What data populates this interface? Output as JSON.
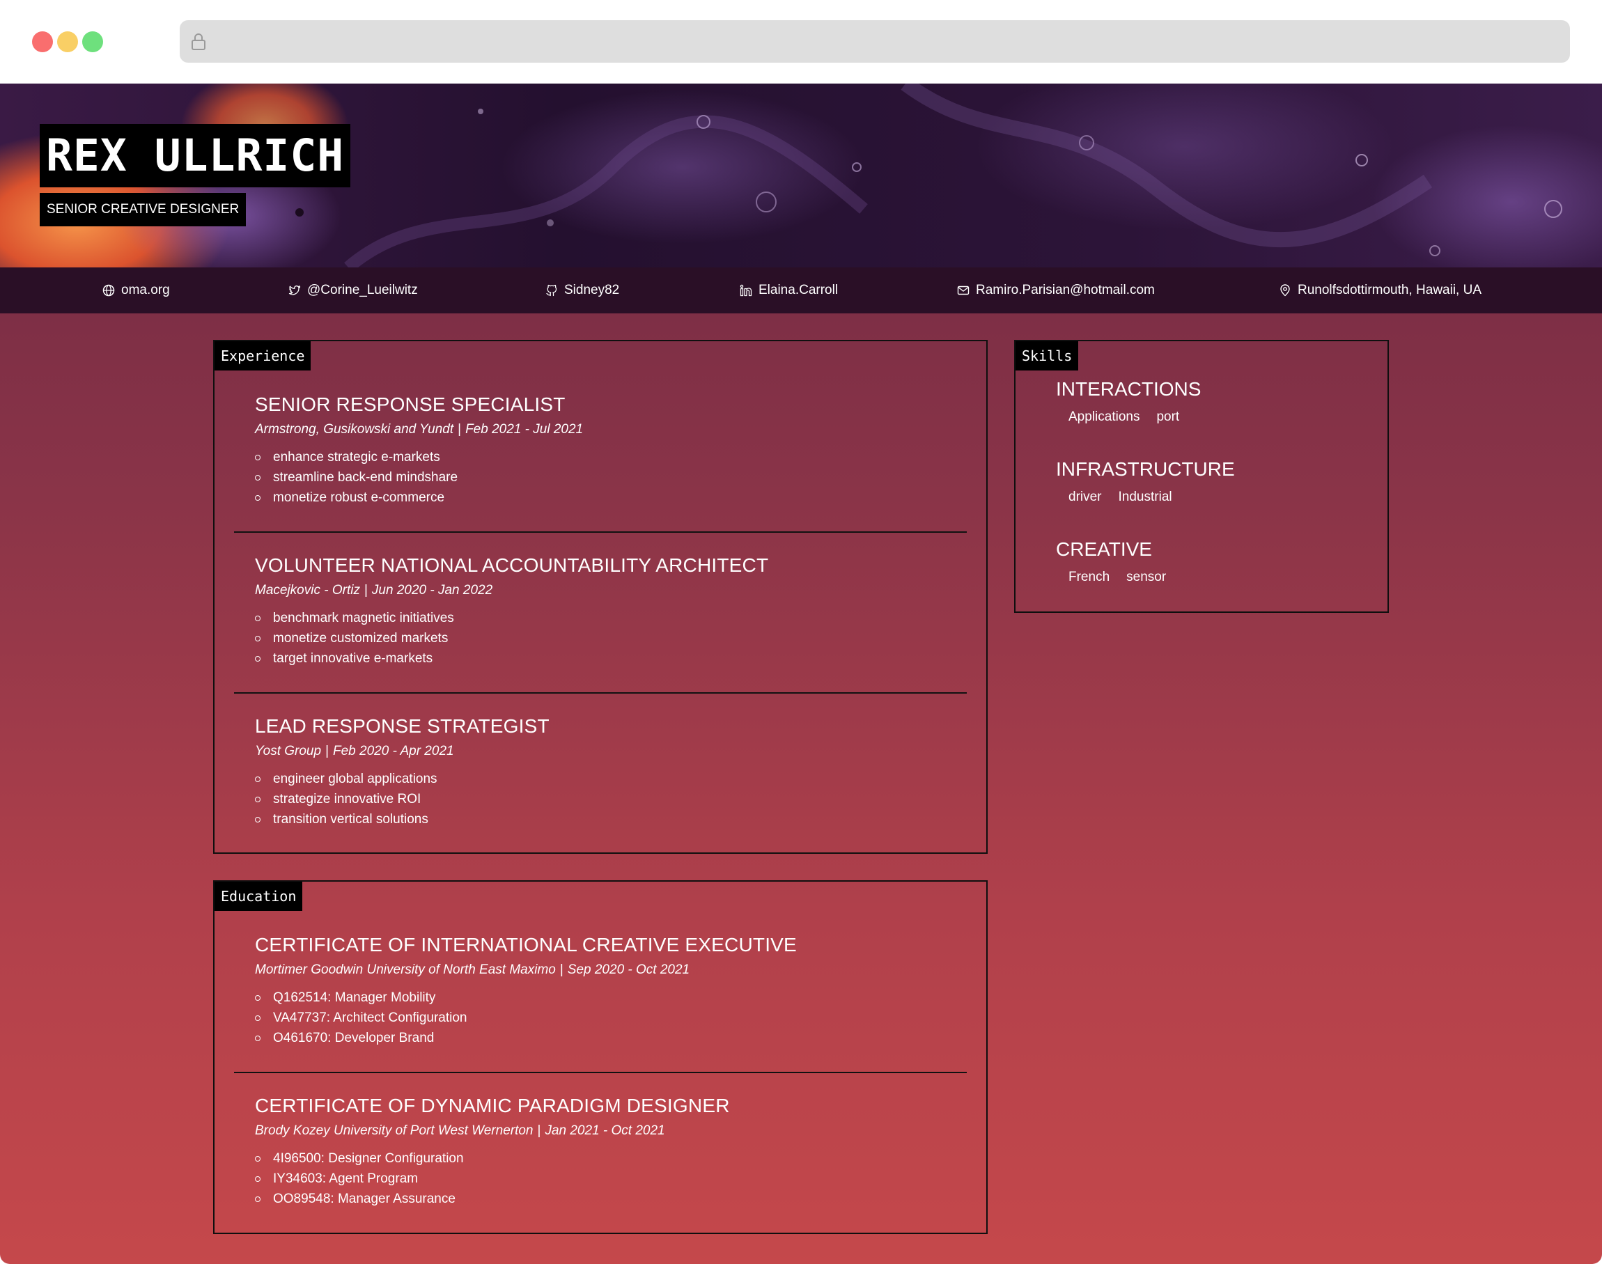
{
  "browser": {
    "window_controls": [
      "close",
      "minimize",
      "maximize"
    ],
    "address_icon": "lock-icon",
    "address_value": ""
  },
  "profile": {
    "name": "REX ULLRICH",
    "title": "SENIOR CREATIVE DESIGNER"
  },
  "contacts": [
    {
      "icon": "globe-icon",
      "text": "oma.org"
    },
    {
      "icon": "twitter-icon",
      "text": "@Corine_Lueilwitz"
    },
    {
      "icon": "github-icon",
      "text": "Sidney82"
    },
    {
      "icon": "linkedin-icon",
      "text": "Elaina.Carroll"
    },
    {
      "icon": "mail-icon",
      "text": "Ramiro.Parisian@hotmail.com"
    },
    {
      "icon": "location-pin-icon",
      "text": "Runolfsdottirmouth, Hawaii, UA"
    }
  ],
  "experience": {
    "label": "Experience",
    "items": [
      {
        "title": "SENIOR RESPONSE SPECIALIST",
        "company": "Armstrong, Gusikowski and Yundt",
        "separator": "|",
        "dates": "Feb 2021 - Jul 2021",
        "bullets": [
          "enhance strategic e-markets",
          "streamline back-end mindshare",
          "monetize robust e-commerce"
        ]
      },
      {
        "title": "VOLUNTEER NATIONAL ACCOUNTABILITY ARCHITECT",
        "company": "Macejkovic - Ortiz",
        "separator": "|",
        "dates": "Jun 2020 - Jan 2022",
        "bullets": [
          "benchmark magnetic initiatives",
          "monetize customized markets",
          "target innovative e-markets"
        ]
      },
      {
        "title": "LEAD RESPONSE STRATEGIST",
        "company": "Yost Group",
        "separator": "|",
        "dates": "Feb 2020 - Apr 2021",
        "bullets": [
          "engineer global applications",
          "strategize innovative ROI",
          "transition vertical solutions"
        ]
      }
    ]
  },
  "education": {
    "label": "Education",
    "items": [
      {
        "title": "CERTIFICATE OF INTERNATIONAL CREATIVE EXECUTIVE",
        "school": "Mortimer Goodwin University of North East Maximo",
        "separator": "|",
        "dates": "Sep 2020 - Oct 2021",
        "bullets": [
          "Q162514: Manager Mobility",
          "VA47737: Architect Configuration",
          "O461670: Developer Brand"
        ]
      },
      {
        "title": "CERTIFICATE OF DYNAMIC PARADIGM DESIGNER",
        "school": "Brody Kozey University of Port West Wernerton",
        "separator": "|",
        "dates": "Jan 2021 - Oct 2021",
        "bullets": [
          "4I96500: Designer Configuration",
          "IY34603: Agent Program",
          "OO89548: Manager Assurance"
        ]
      }
    ]
  },
  "skills": {
    "label": "Skills",
    "groups": [
      {
        "title": "INTERACTIONS",
        "tags": [
          "Applications",
          "port"
        ]
      },
      {
        "title": "INFRASTRUCTURE",
        "tags": [
          "driver",
          "Industrial"
        ]
      },
      {
        "title": "CREATIVE",
        "tags": [
          "French",
          "sensor"
        ]
      }
    ]
  },
  "colors": {
    "page_gradient_top": "#6f2843",
    "page_gradient_bottom": "#c5484b",
    "contact_bar": "#2a0f26",
    "label_background": "#000000",
    "text": "#ffffff"
  }
}
